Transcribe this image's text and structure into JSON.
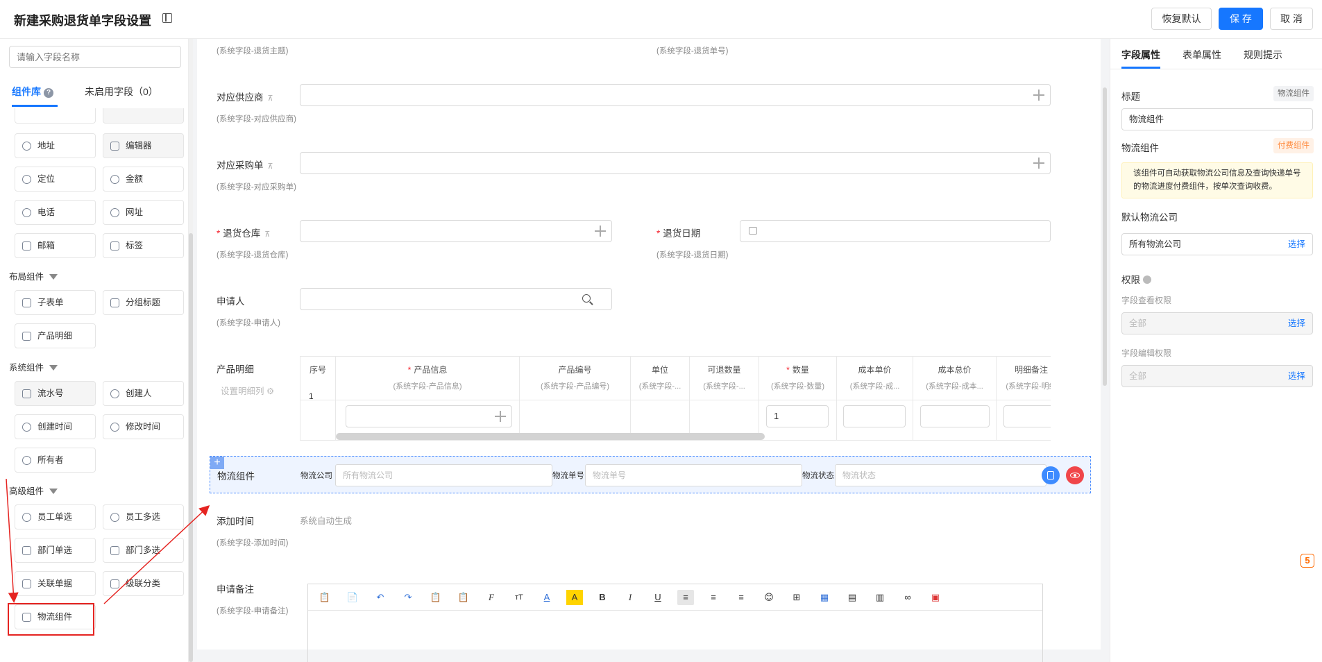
{
  "header": {
    "title": "新建采购退货单字段设置",
    "restore_label": "恢复默认",
    "save_label": "保 存",
    "cancel_label": "取 消"
  },
  "left": {
    "search_placeholder": "请输入字段名称",
    "tabs": [
      "组件库",
      "未启用字段（0）"
    ],
    "help_mark": "?",
    "basic_components": [
      {
        "label": "地址",
        "icon": "location-pin-icon"
      },
      {
        "label": "编辑器",
        "icon": "editor-icon"
      },
      {
        "label": "定位",
        "icon": "position-icon"
      },
      {
        "label": "金额",
        "icon": "amount-icon"
      },
      {
        "label": "电话",
        "icon": "phone-icon"
      },
      {
        "label": "网址",
        "icon": "globe-icon"
      },
      {
        "label": "邮箱",
        "icon": "mail-icon"
      },
      {
        "label": "标签",
        "icon": "tag-icon"
      }
    ],
    "layout_group": "布局组件",
    "layout_components": [
      {
        "label": "子表单",
        "icon": "table-icon"
      },
      {
        "label": "分组标题",
        "icon": "group-title-icon"
      },
      {
        "label": "产品明细",
        "icon": "table-icon"
      }
    ],
    "system_group": "系统组件",
    "system_components": [
      {
        "label": "流水号",
        "icon": "serial-icon"
      },
      {
        "label": "创建人",
        "icon": "user-icon"
      },
      {
        "label": "创建时间",
        "icon": "clock-icon"
      },
      {
        "label": "修改时间",
        "icon": "clock-edit-icon"
      },
      {
        "label": "所有者",
        "icon": "user-icon"
      }
    ],
    "advanced_group": "高级组件",
    "advanced_components": [
      {
        "label": "员工单选",
        "icon": "user-icon"
      },
      {
        "label": "员工多选",
        "icon": "users-icon"
      },
      {
        "label": "部门单选",
        "icon": "org-icon"
      },
      {
        "label": "部门多选",
        "icon": "org-icon"
      },
      {
        "label": "关联单据",
        "icon": "link-doc-icon"
      },
      {
        "label": "级联分类",
        "icon": "cascade-icon"
      },
      {
        "label": "物流组件",
        "icon": "truck-icon"
      }
    ]
  },
  "form": {
    "top_hints": [
      "(系统字段-退货主题)",
      "(系统字段-退货单号)"
    ],
    "supplier": {
      "label": "对应供应商",
      "hint": "(系统字段-对应供应商)"
    },
    "purchase": {
      "label": "对应采购单",
      "hint": "(系统字段-对应采购单)"
    },
    "warehouse": {
      "label": "退货仓库",
      "hint": "(系统字段-退货仓库)"
    },
    "return_date": {
      "label": "退货日期",
      "hint": "(系统字段-退货日期)"
    },
    "applicant": {
      "label": "申请人",
      "hint": "(系统字段-申请人)"
    },
    "product": {
      "label": "产品明细",
      "settings_link": "设置明细列"
    },
    "table": {
      "columns": [
        {
          "title": "序号",
          "sub": ""
        },
        {
          "title": "产品信息",
          "sub": "(系统字段-产品信息)",
          "required": true
        },
        {
          "title": "产品编号",
          "sub": "(系统字段-产品编号)"
        },
        {
          "title": "单位",
          "sub": "(系统字段-..."
        },
        {
          "title": "可退数量",
          "sub": "(系统字段-..."
        },
        {
          "title": "数量",
          "sub": "(系统字段-数量)",
          "required": true
        },
        {
          "title": "成本单价",
          "sub": "(系统字段-成..."
        },
        {
          "title": "成本总价",
          "sub": "(系统字段-成本..."
        },
        {
          "title": "明细备注",
          "sub": "(系统字段-明细"
        }
      ],
      "row_index": "1",
      "qty_value": "1"
    },
    "logistics": {
      "label": "物流组件",
      "company_label": "物流公司",
      "company_placeholder": "所有物流公司",
      "number_label": "物流单号",
      "number_placeholder": "物流单号",
      "status_label": "物流状态",
      "status_placeholder": "物流状态"
    },
    "add_time": {
      "label": "添加时间",
      "value": "系统自动生成",
      "hint": "(系统字段-添加时间)"
    },
    "remark": {
      "label": "申请备注",
      "hint": "(系统字段-申请备注)"
    },
    "required_mark": "*"
  },
  "editor_tools": [
    "📋",
    "📄",
    "↶",
    "↷",
    "📋",
    "📋",
    "F",
    "тT",
    "A",
    "A",
    "B",
    "I",
    "U",
    "≡",
    "≡",
    "≡",
    "😊",
    "⊞",
    "▦",
    "▤",
    "▥",
    "∞",
    "▣"
  ],
  "right": {
    "tabs": [
      "字段属性",
      "表单属性",
      "规则提示"
    ],
    "title_label": "标题",
    "title_badge": "物流组件",
    "title_value": "物流组件",
    "component_label": "物流组件",
    "paid_badge": "付费组件",
    "notice": "该组件可自动获取物流公司信息及查询快递单号的物流进度付费组件，按单次查询收费。",
    "default_company_label": "默认物流公司",
    "default_company_value": "所有物流公司",
    "select_label": "选择",
    "permission_label": "权限",
    "view_perm_label": "字段查看权限",
    "view_perm_value": "全部",
    "edit_perm_label": "字段编辑权限",
    "edit_perm_value": "全部"
  },
  "colors": {
    "primary": "#1677ff",
    "highlight_red": "#e52421",
    "paid_badge": "#ff8a3d"
  }
}
